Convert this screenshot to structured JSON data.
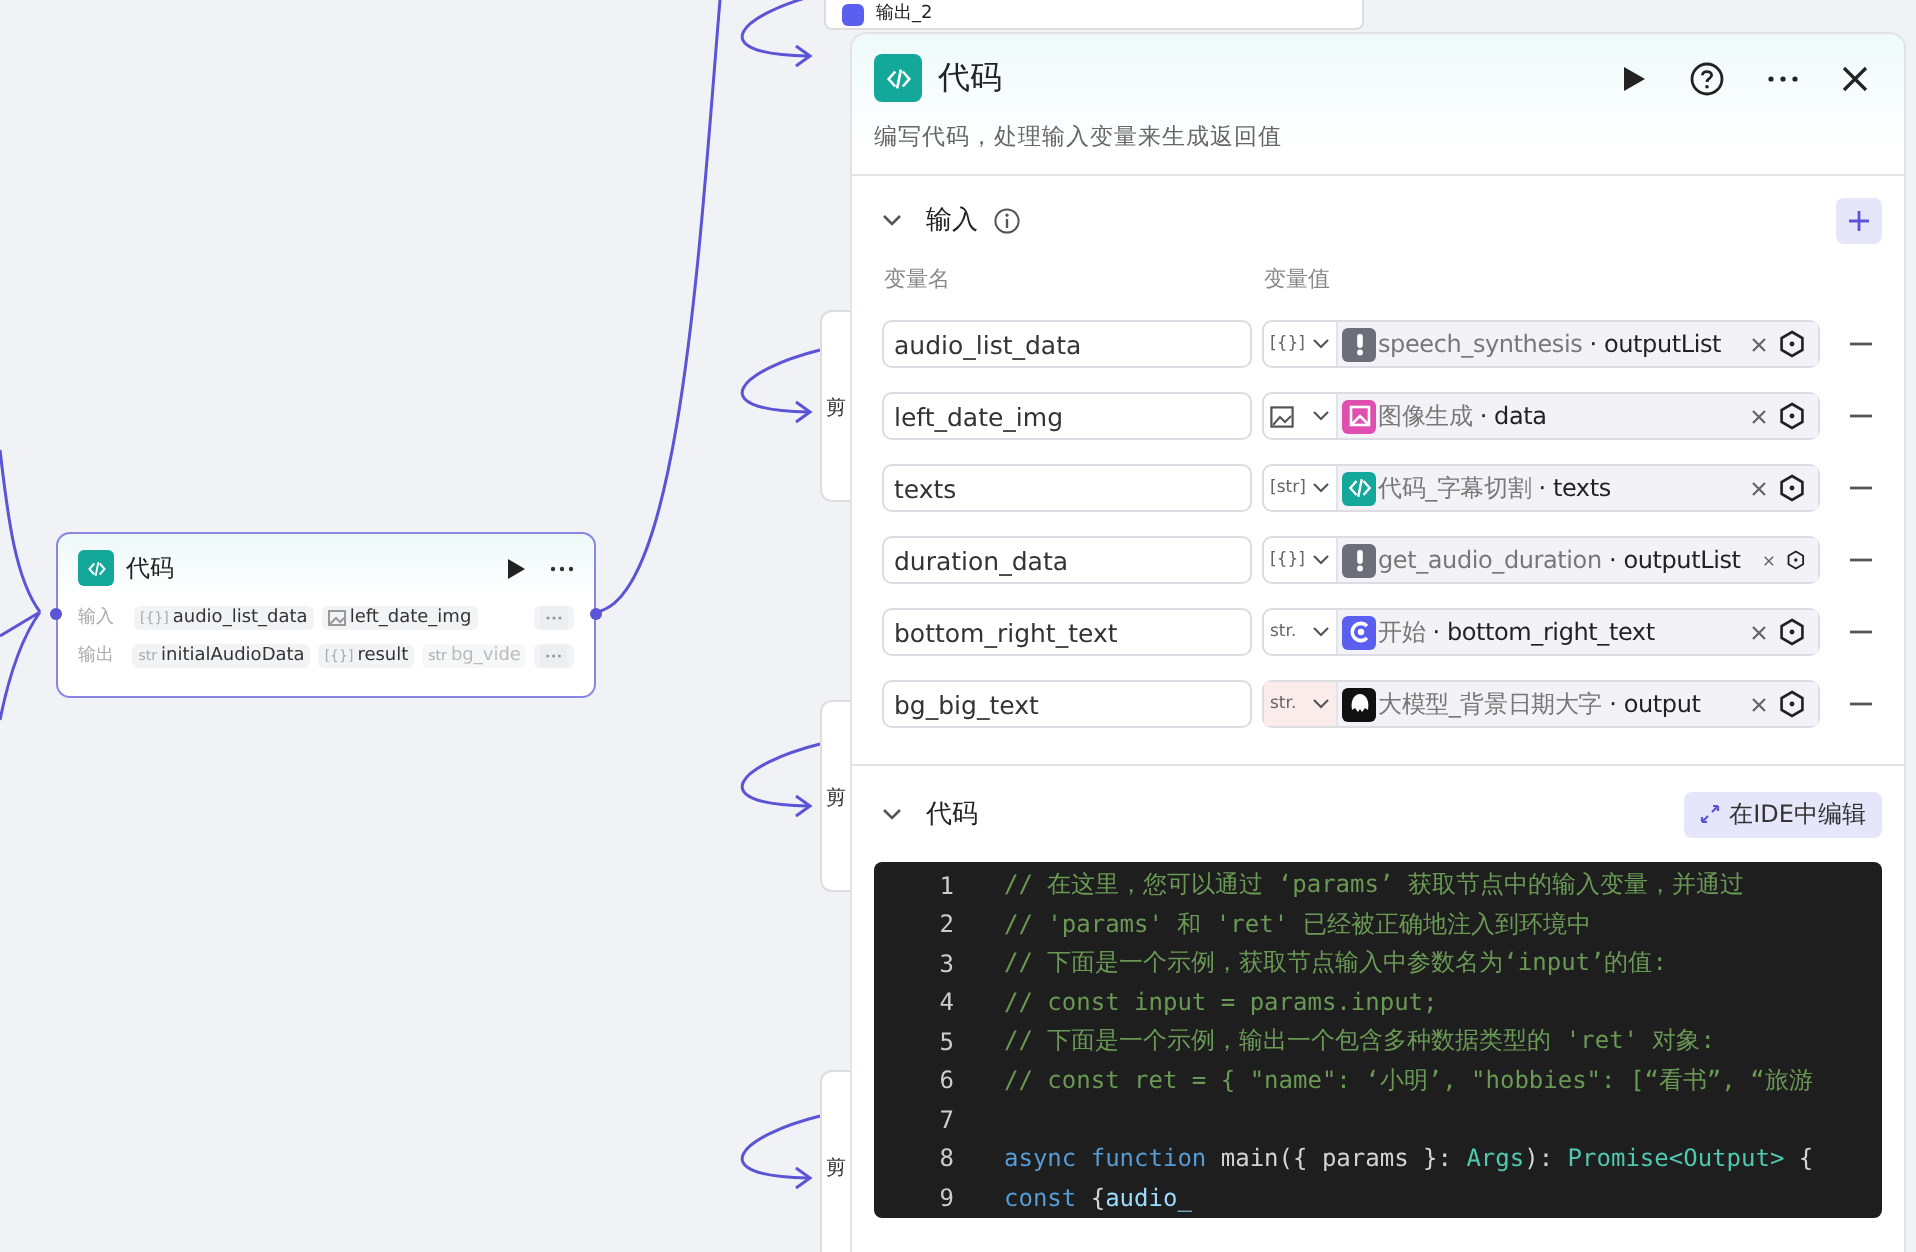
{
  "canvas": {
    "top_node": {
      "title": "输出_2"
    },
    "side_nodes": [
      {
        "label": "剪"
      },
      {
        "label": "剪"
      },
      {
        "label": "剪"
      }
    ],
    "node": {
      "title": "代码",
      "rows": [
        {
          "label": "输入",
          "chips": [
            {
              "type": {
                "kind": "text",
                "label": "[{}]"
              },
              "name": "audio_list_data",
              "faded": false
            },
            {
              "type": {
                "kind": "image"
              },
              "name": "left_date_img",
              "faded": false
            }
          ]
        },
        {
          "label": "输出",
          "chips": [
            {
              "type": {
                "kind": "text",
                "label": "str"
              },
              "name": "initialAudioData",
              "faded": false
            },
            {
              "type": {
                "kind": "text",
                "label": "[{}]"
              },
              "name": "result",
              "faded": false
            },
            {
              "type": {
                "kind": "text",
                "label": "str"
              },
              "name": "bg_vide",
              "faded": true
            }
          ]
        }
      ]
    }
  },
  "panel": {
    "title": "代码",
    "description": "编写代码，处理输入变量来生成返回值",
    "inputs": {
      "title": "输入",
      "expanded": true,
      "columns": [
        "变量名",
        "变量值"
      ],
      "rows": [
        {
          "name": "audio_list_data",
          "type": {
            "kind": "text",
            "label": "[{}]"
          },
          "highlighted": false,
          "source": {
            "kind": "plugin",
            "node": "speech_synthesis",
            "separator": "·",
            "field": "outputList"
          }
        },
        {
          "name": "left_date_img",
          "type": {
            "kind": "image"
          },
          "highlighted": false,
          "source": {
            "kind": "image",
            "node": "图像生成",
            "separator": "·",
            "field": "data"
          }
        },
        {
          "name": "texts",
          "type": {
            "kind": "text",
            "label": "[str]"
          },
          "highlighted": false,
          "source": {
            "kind": "code",
            "node": "代码_字幕切割",
            "separator": "·",
            "field": "texts"
          }
        },
        {
          "name": "duration_data",
          "type": {
            "kind": "text",
            "label": "[{}]"
          },
          "highlighted": false,
          "source": {
            "kind": "plugin",
            "node": "get_audio_duration",
            "separator": "·",
            "field": "outputList"
          }
        },
        {
          "name": "bottom_right_text",
          "type": {
            "kind": "text",
            "label": "str."
          },
          "highlighted": false,
          "source": {
            "kind": "start",
            "node": "开始",
            "separator": "·",
            "field": "bottom_right_text"
          }
        },
        {
          "name": "bg_big_text",
          "type": {
            "kind": "text",
            "label": "str."
          },
          "highlighted": true,
          "source": {
            "kind": "llm",
            "node": "大模型_背景日期大字",
            "separator": "·",
            "field": "output"
          }
        }
      ]
    },
    "code": {
      "title": "代码",
      "expanded": true,
      "ide_button": "在IDE中编辑",
      "lines": [
        {
          "number": "1",
          "tokens": [
            {
              "kind": "comment",
              "text": "// 在这里，您可以通过 ‘params’  获取节点中的输入变量，并通过"
            }
          ]
        },
        {
          "number": "2",
          "tokens": [
            {
              "kind": "comment",
              "text": "// 'params' 和 'ret' 已经被正确地注入到环境中"
            }
          ]
        },
        {
          "number": "3",
          "tokens": [
            {
              "kind": "comment",
              "text": "// 下面是一个示例，获取节点输入中参数名为‘input’的值:"
            }
          ]
        },
        {
          "number": "4",
          "tokens": [
            {
              "kind": "comment",
              "text": "// const input = params.input;"
            }
          ]
        },
        {
          "number": "5",
          "tokens": [
            {
              "kind": "comment",
              "text": "// 下面是一个示例，输出一个包含多种数据类型的 'ret' 对象:"
            }
          ]
        },
        {
          "number": "6",
          "tokens": [
            {
              "kind": "comment",
              "text": "// const ret = { \"name\": ‘小明’, \"hobbies\": [“看书”, “旅游"
            }
          ]
        },
        {
          "number": "7"
        },
        {
          "number": "8",
          "tokens": [
            {
              "kind": "keyword",
              "text": "async function"
            },
            {
              "kind": "plain",
              "text": " main({ params }: "
            },
            {
              "kind": "type",
              "text": "Args"
            },
            {
              "kind": "plain",
              "text": "): "
            },
            {
              "kind": "type",
              "text": "Promise<Output>"
            },
            {
              "kind": "plain",
              "text": " {"
            }
          ]
        },
        {
          "number": "9",
          "tokens": [
            {
              "kind": "keyword",
              "text": "    const"
            },
            {
              "kind": "plain",
              "text": "  {"
            },
            {
              "kind": "variable",
              "text": "audio_"
            }
          ]
        }
      ]
    }
  }
}
